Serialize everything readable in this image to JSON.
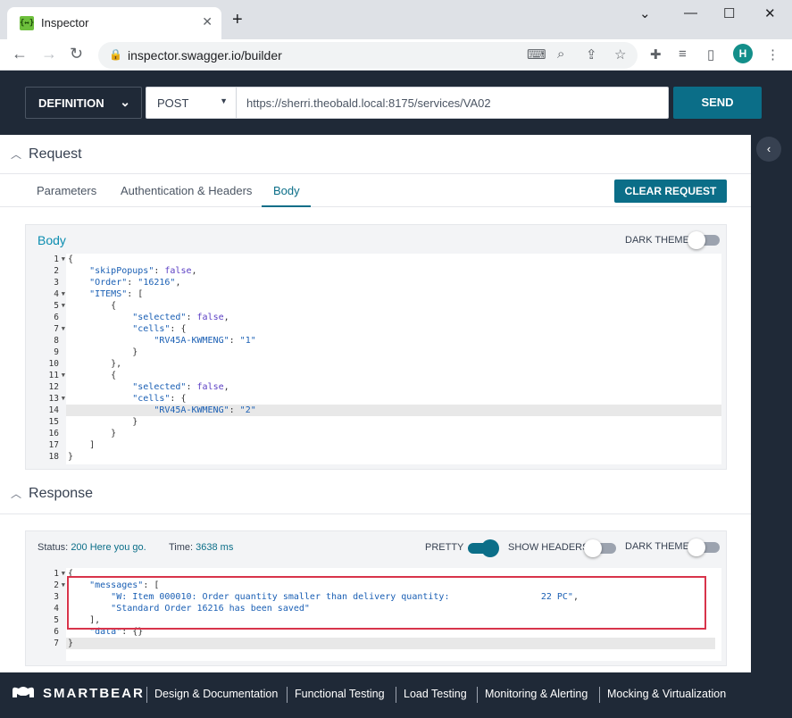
{
  "browser": {
    "tab_title": "Inspector",
    "favicon_text": "{↔}",
    "url": "inspector.swagger.io/builder",
    "profile_initial": "H"
  },
  "header": {
    "definition_label": "DEFINITION",
    "method": "POST",
    "request_url": "https://sherri.theobald.local:8175/services/VA02",
    "send_label": "SEND"
  },
  "request": {
    "section_title": "Request",
    "tabs": [
      "Parameters",
      "Authentication & Headers",
      "Body"
    ],
    "active_tab": "Body",
    "clear_label": "CLEAR REQUEST",
    "body_label": "Body",
    "dark_theme_label": "DARK THEME",
    "lines": [
      "{",
      "    \"skipPopups\": false,",
      "    \"Order\": \"16216\",",
      "    \"ITEMS\": [",
      "        {",
      "            \"selected\": false,",
      "            \"cells\": {",
      "                \"RV45A-KWMENG\": \"1\"",
      "            }",
      "        },",
      "        {",
      "            \"selected\": false,",
      "            \"cells\": {",
      "                \"RV45A-KWMENG\": \"2\"",
      "            }",
      "        }",
      "    ]",
      "}"
    ]
  },
  "response": {
    "section_title": "Response",
    "status_label": "Status:",
    "status_value": "200 Here you go.",
    "time_label": "Time:",
    "time_value": "3638 ms",
    "pretty_label": "PRETTY",
    "show_headers_label": "SHOW HEADERS",
    "dark_theme_label": "DARK THEME",
    "lines": [
      "{",
      "    \"messages\": [",
      "        \"W: Item 000010: Order quantity smaller than delivery quantity:                 22 PC\",",
      "        \"Standard Order 16216 has been saved\"",
      "    ],",
      "    \"data\": {}",
      "}"
    ]
  },
  "footer": {
    "brand": "SMARTBEAR",
    "links": [
      "Design & Documentation",
      "Functional Testing",
      "Load Testing",
      "Monitoring & Alerting",
      "Mocking & Virtualization"
    ]
  },
  "colors": {
    "accent": "#0b6e88",
    "header_bg": "#1f2937",
    "highlight": "#d8344b"
  }
}
